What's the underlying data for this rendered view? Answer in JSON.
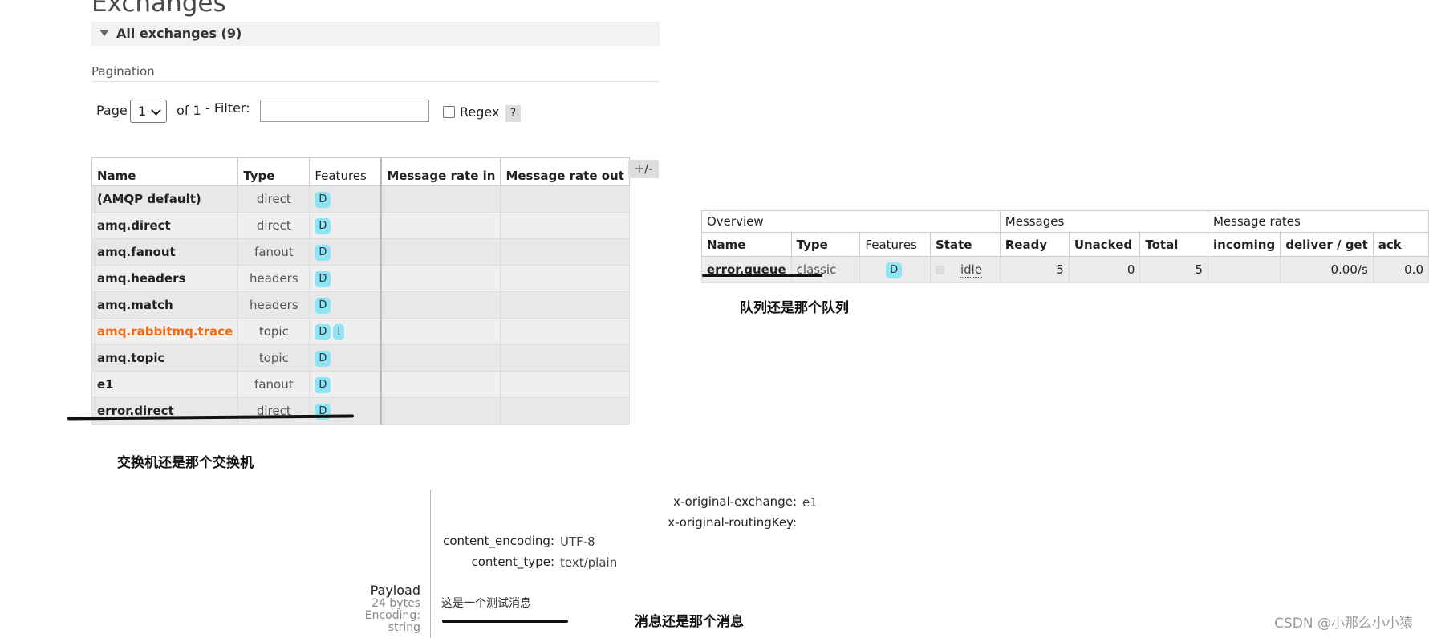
{
  "exchanges": {
    "heading": "Exchanges",
    "all_label": "All exchanges (9)",
    "pagination_heading": "Pagination",
    "pagination": {
      "page_label": "Page",
      "page_value": "1",
      "of_label": "of 1",
      "filter_label": "- Filter:",
      "filter_value": "",
      "regex_label": "Regex",
      "help_label": "?"
    },
    "columns": [
      "Name",
      "Type",
      "Features",
      "Message rate in",
      "Message rate out"
    ],
    "toggle_columns": "+/-",
    "rows": [
      {
        "name": "(AMQP default)",
        "type": "direct",
        "features": [
          "D"
        ]
      },
      {
        "name": "amq.direct",
        "type": "direct",
        "features": [
          "D"
        ]
      },
      {
        "name": "amq.fanout",
        "type": "fanout",
        "features": [
          "D"
        ]
      },
      {
        "name": "amq.headers",
        "type": "headers",
        "features": [
          "D"
        ]
      },
      {
        "name": "amq.match",
        "type": "headers",
        "features": [
          "D"
        ]
      },
      {
        "name": "amq.rabbitmq.trace",
        "type": "topic",
        "features": [
          "D",
          "I"
        ],
        "highlight_color": "#ef6c1a"
      },
      {
        "name": "amq.topic",
        "type": "topic",
        "features": [
          "D"
        ]
      },
      {
        "name": "e1",
        "type": "fanout",
        "features": [
          "D"
        ]
      },
      {
        "name": "error.direct",
        "type": "direct",
        "features": [
          "D"
        ]
      }
    ],
    "caption": "交换机还是那个交换机"
  },
  "queue": {
    "groups": {
      "overview": "Overview",
      "messages": "Messages",
      "message_rates": "Message rates"
    },
    "columns": [
      "Name",
      "Type",
      "Features",
      "State",
      "Ready",
      "Unacked",
      "Total",
      "incoming",
      "deliver / get",
      "ack"
    ],
    "row": {
      "name": "error.queue",
      "type": "classic",
      "feature": "D",
      "state": "idle",
      "ready": "5",
      "unacked": "0",
      "total": "5",
      "incoming": "",
      "deliver_get": "0.00/s",
      "ack": "0.0"
    },
    "caption": "队列还是那个队列"
  },
  "message": {
    "headers": [
      {
        "key": "x-original-exchange:",
        "value": "e1"
      },
      {
        "key": "x-original-routingKey:",
        "value": ""
      }
    ],
    "properties": [
      {
        "key": "content_encoding:",
        "value": "UTF-8"
      },
      {
        "key": "content_type:",
        "value": "text/plain"
      }
    ],
    "payload_label": "Payload",
    "payload_size": "24 bytes",
    "encoding_label": "Encoding:",
    "encoding_value": "string",
    "payload_text": "这是一个测试消息",
    "caption": "消息还是那个消息"
  },
  "colors": {
    "feature_badge": "#8ee3f5",
    "trace_exchange": "#ef6c1a"
  },
  "watermark": "CSDN @小那么小小猿"
}
